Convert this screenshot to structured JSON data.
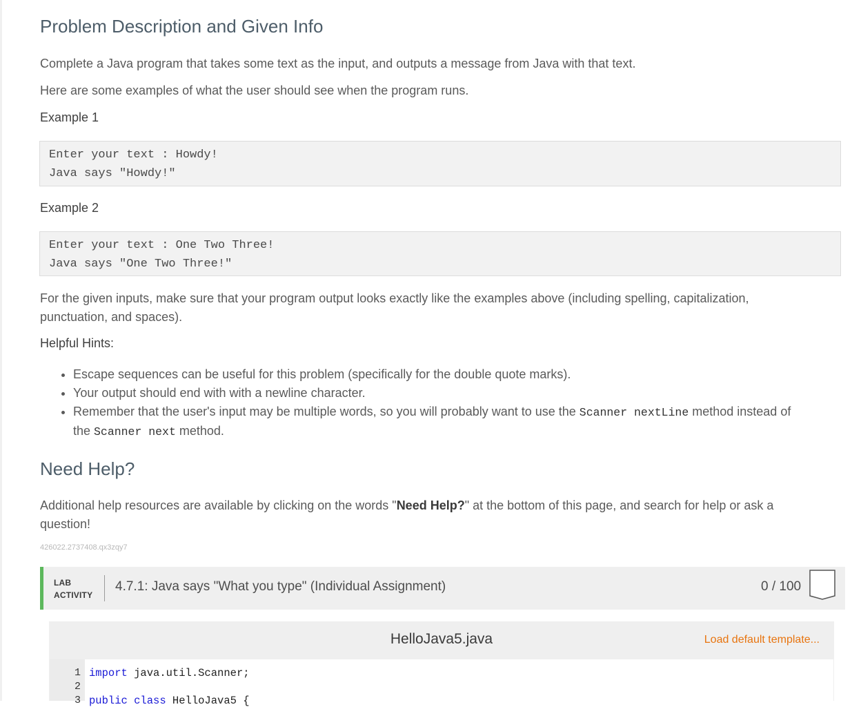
{
  "problem": {
    "title": "Problem Description and Given Info",
    "intro": "Complete a Java program that takes some text as the input, and outputs a message from Java with that text.",
    "examples_intro": "Here are some examples of what the user should see when the program runs.",
    "example1_label": "Example 1",
    "example1_line1": "Enter your text : Howdy!",
    "example1_line2": "Java says \"Howdy!\"",
    "example2_label": "Example 2",
    "example2_line1": "Enter your text : One Two Three!",
    "example2_line2": "Java says \"One Two Three!\"",
    "instructions_line1": "For the given inputs, make sure that your program output looks exactly like the examples above (including spelling, capitalization,",
    "instructions_line2": "punctuation, and spaces).",
    "hints_label": "Helpful Hints:",
    "hint1": "Escape sequences can be useful for this problem (specifically for the double quote marks).",
    "hint2": "Your output should end with with a newline character.",
    "hint3_part1": "Remember that the user's input may be multiple words, so you will probably want to use the ",
    "hint3_code1": "Scanner nextLine",
    "hint3_part2": " method instead of",
    "hint3_part3": "the ",
    "hint3_code2": "Scanner next",
    "hint3_part4": " method."
  },
  "help": {
    "title": "Need Help?",
    "text_part1": "Additional help resources are available by clicking on the words \"",
    "text_bold": "Need Help?",
    "text_part2": "\" at the bottom of this page, and search for help or ask a",
    "text_line2": "question!",
    "content_id": "426022.2737408.qx3zqy7"
  },
  "lab": {
    "tag_line1": "LAB",
    "tag_line2": "ACTIVITY",
    "title": "4.7.1: Java says \"What you type\" (Individual Assignment)",
    "score": "0 / 100",
    "accent_color": "#5cb85c"
  },
  "editor": {
    "filename": "HelloJava5.java",
    "load_template": "Load default template...",
    "lines": [
      {
        "num": "1",
        "keyword": "import",
        "rest": " java.util.Scanner;"
      },
      {
        "num": "2",
        "keyword": "",
        "rest": ""
      },
      {
        "num": "3",
        "keyword": "public class",
        "rest": " HelloJava5 {"
      }
    ]
  }
}
